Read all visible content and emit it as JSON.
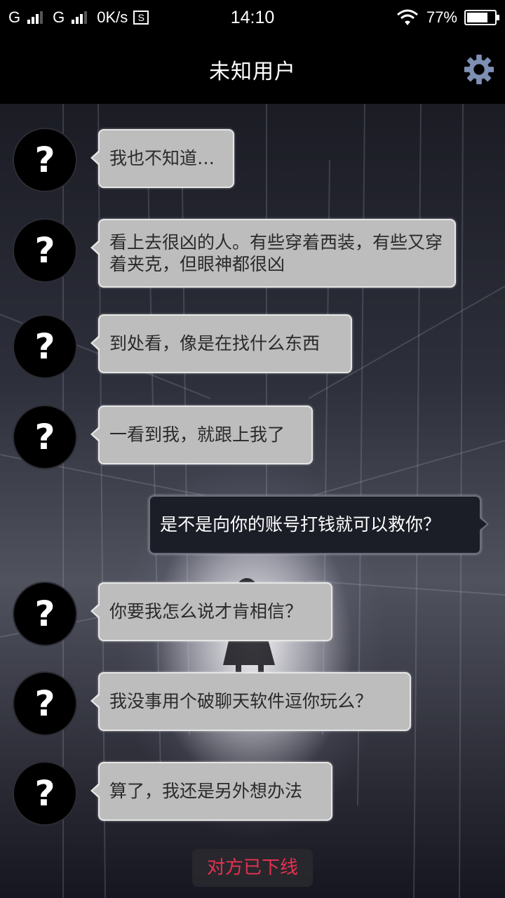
{
  "status_bar": {
    "sim1": "G",
    "sim2": "G",
    "net_speed": "0K/s",
    "net_icon": "S",
    "time": "14:10",
    "battery": "77%",
    "battery_level": 0.77
  },
  "header": {
    "title": "未知用户",
    "settings_icon": "gear-icon"
  },
  "avatar_glyph": "?",
  "messages": [
    {
      "from": "other",
      "text": "我也不知道…"
    },
    {
      "from": "other",
      "text": "看上去很凶的人。有些穿着西装，有些又穿着夹克，但眼神都很凶"
    },
    {
      "from": "other",
      "text": "到处看，像是在找什么东西"
    },
    {
      "from": "other",
      "text": "一看到我，就跟上我了"
    },
    {
      "from": "me",
      "text": "是不是向你的账号打钱就可以救你？"
    },
    {
      "from": "other",
      "text": "你要我怎么说才肯相信？"
    },
    {
      "from": "other",
      "text": "我没事用个破聊天软件逗你玩么？"
    },
    {
      "from": "other",
      "text": "算了，我还是另外想办法"
    }
  ],
  "system_notice": "对方已下线",
  "colors": {
    "accent_gear": "#7d8fb3",
    "offline_text": "#e8304f",
    "other_bubble": "#bdbdbd",
    "my_bubble": "#1b1d27"
  }
}
